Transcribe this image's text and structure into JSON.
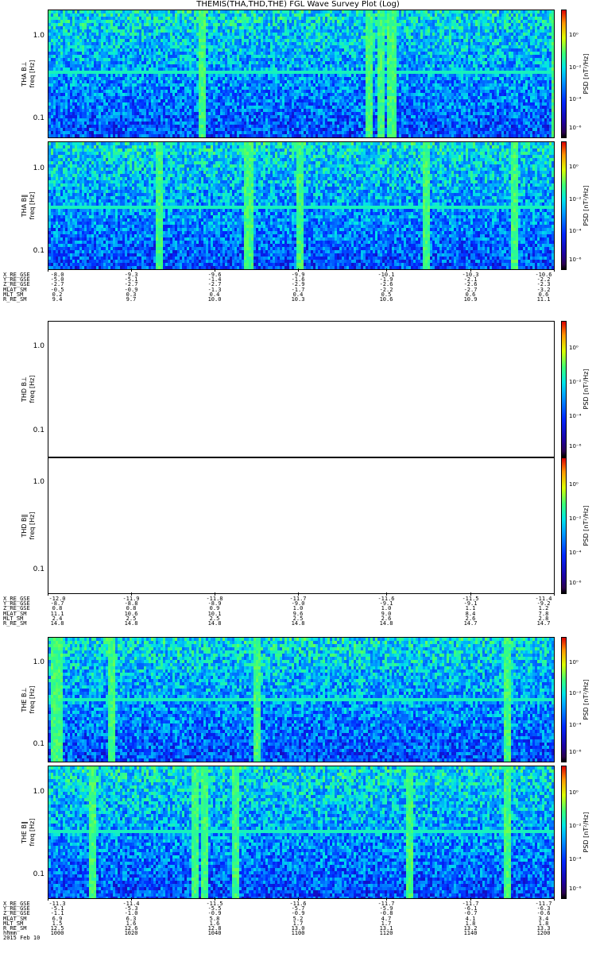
{
  "title": "THEMIS(THA,THD,THE) FGL Wave Survey Plot (Log)",
  "chart_data": [
    {
      "type": "heatmap",
      "probe": "THA",
      "ylabel": "THA B⊥",
      "yunits": "freq [Hz]",
      "yticks": [
        "1.0",
        "0.1"
      ],
      "zlabel": "PSD [nT²/Hz]",
      "ztick_labels": [
        "10⁰",
        "10⁻²",
        "10⁻⁴",
        "10⁻⁶"
      ],
      "scale": "log",
      "empty": false
    },
    {
      "type": "heatmap",
      "probe": "THA",
      "ylabel": "THA B‖",
      "yunits": "freq [Hz]",
      "yticks": [
        "1.0",
        "0.1"
      ],
      "zlabel": "PSD [nT²/Hz]",
      "ztick_labels": [
        "10⁰",
        "10⁻²",
        "10⁻⁴",
        "10⁻⁶"
      ],
      "scale": "log",
      "empty": false
    },
    {
      "type": "heatmap",
      "probe": "THD",
      "ylabel": "THD B⊥",
      "yunits": "freq [Hz]",
      "yticks": [
        "1.0",
        "0.1"
      ],
      "zlabel": "PSD [nT²/Hz]",
      "ztick_labels": [
        "10⁰",
        "10⁻²",
        "10⁻⁴",
        "10⁻⁶"
      ],
      "scale": "log",
      "empty": true
    },
    {
      "type": "heatmap",
      "probe": "THD",
      "ylabel": "THD B‖",
      "yunits": "freq [Hz]",
      "yticks": [
        "1.0",
        "0.1"
      ],
      "zlabel": "PSD [nT²/Hz]",
      "ztick_labels": [
        "10⁰",
        "10⁻²",
        "10⁻⁴",
        "10⁻⁶"
      ],
      "scale": "log",
      "empty": true
    },
    {
      "type": "heatmap",
      "probe": "THE",
      "ylabel": "THE B⊥",
      "yunits": "freq [Hz]",
      "yticks": [
        "1.0",
        "0.1"
      ],
      "zlabel": "PSD [nT²/Hz]",
      "ztick_labels": [
        "10⁰",
        "10⁻²",
        "10⁻⁴",
        "10⁻⁶"
      ],
      "scale": "log",
      "empty": false
    },
    {
      "type": "heatmap",
      "probe": "THE",
      "ylabel": "THE B‖",
      "yunits": "freq [Hz]",
      "yticks": [
        "1.0",
        "0.1"
      ],
      "zlabel": "PSD [nT²/Hz]",
      "ztick_labels": [
        "10⁰",
        "10⁻²",
        "10⁻⁴",
        "10⁻⁶"
      ],
      "scale": "log",
      "empty": false
    }
  ],
  "ephemeris": [
    {
      "labels": [
        "X_RE_GSE",
        "Y_RE_GSE",
        "Z_RE_GSE",
        "MLAT_SM",
        "MLT_SM",
        "R_RE_SM"
      ],
      "columns": [
        [
          "-8.0",
          "-5.0",
          "-2.7",
          "-0.5",
          "0.2",
          "9.4"
        ],
        [
          "-9.3",
          "-5.1",
          "-2.7",
          "-0.9",
          "0.3",
          "9.7"
        ],
        [
          "-9.6",
          "-1.4",
          "-2.7",
          "-1.3",
          "0.4",
          "10.0"
        ],
        [
          "-9.9",
          "-1.6",
          "-2.9",
          "-1.7",
          "0.4",
          "10.3"
        ],
        [
          "-10.1",
          "-1.9",
          "-2.6",
          "-2.2",
          "0.5",
          "10.6"
        ],
        [
          "-10.3",
          "-2.1",
          "-2.6",
          "-2.7",
          "0.6",
          "10.9"
        ],
        [
          "-10.6",
          "-2.2",
          "-2.3",
          "-3.2",
          "0.6",
          "11.1"
        ]
      ]
    },
    {
      "labels": [
        "X_RE_GSE",
        "Y_RE_GSE",
        "Z_RE_GSE",
        "MLAT_SM",
        "MLT_SM",
        "R_RE_SM"
      ],
      "columns": [
        [
          "-12.0",
          "-8.7",
          "0.8",
          "11.1",
          "2.4",
          "14.8"
        ],
        [
          "-11.9",
          "-8.8",
          "0.8",
          "10.6",
          "2.5",
          "14.8"
        ],
        [
          "-11.8",
          "-8.9",
          "0.9",
          "10.1",
          "2.5",
          "14.8"
        ],
        [
          "-11.7",
          "-9.0",
          "1.0",
          "9.6",
          "2.5",
          "14.8"
        ],
        [
          "-11.6",
          "-9.1",
          "1.0",
          "9.0",
          "2.6",
          "14.8"
        ],
        [
          "-11.5",
          "-9.1",
          "1.1",
          "8.4",
          "2.6",
          "14.7"
        ],
        [
          "-11.4",
          "-9.2",
          "1.2",
          "7.8",
          "2.8",
          "14.7"
        ]
      ]
    },
    {
      "labels": [
        "X_RE_GSE",
        "Y_RE_GSE",
        "Z_RE_GSE",
        "MLAT_SM",
        "MLT_SM",
        "R_RE_SM",
        "hhmm",
        "2015 Feb 10"
      ],
      "columns": [
        [
          "-11.3",
          "-5.1",
          "-1.1",
          "6.9",
          "1.5",
          "12.5",
          "1000"
        ],
        [
          "-11.4",
          "-5.3",
          "-1.0",
          "6.3",
          "1.6",
          "12.6",
          "1020"
        ],
        [
          "-11.5",
          "-5.5",
          "-0.9",
          "5.8",
          "1.6",
          "12.8",
          "1040"
        ],
        [
          "-11.6",
          "-5.7",
          "-0.9",
          "5.2",
          "1.7",
          "13.0",
          "1100"
        ],
        [
          "-11.7",
          "-5.9",
          "-0.8",
          "4.7",
          "1.7",
          "13.1",
          "1120"
        ],
        [
          "-11.7",
          "-6.1",
          "-0.7",
          "4.1",
          "1.8",
          "13.2",
          "1140"
        ],
        [
          "-11.7",
          "-6.3",
          "-0.6",
          "3.4",
          "1.8",
          "13.3",
          "1200"
        ]
      ]
    }
  ]
}
